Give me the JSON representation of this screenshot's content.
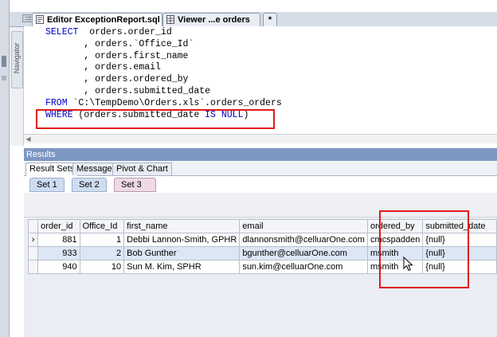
{
  "tabs": [
    {
      "label": "Editor ExceptionReport.sql"
    },
    {
      "label": "Viewer ...e orders"
    },
    {
      "label": "*"
    }
  ],
  "navigator": {
    "label": "Navigator"
  },
  "editor": {
    "lines": [
      {
        "kw": "SELECT",
        "text": "  orders.order_id"
      },
      {
        "kw": "",
        "text": "       , orders.`Office_Id`"
      },
      {
        "kw": "",
        "text": "       , orders.first_name"
      },
      {
        "kw": "",
        "text": "       , orders.email"
      },
      {
        "kw": "",
        "text": "       , orders.ordered_by"
      },
      {
        "kw": "",
        "text": "       , orders.submitted_date"
      },
      {
        "kw": "FROM",
        "text": " `C:\\TempDemo\\Orders.xls`.orders_orders"
      },
      {
        "kw": "WHERE",
        "text": " (orders.submitted_date ",
        "kw2": "IS NULL",
        "tail": ")"
      }
    ]
  },
  "results": {
    "title": "Results",
    "tabs": [
      "Result Sets",
      "Messages",
      "Pivot & Chart"
    ],
    "sets": [
      "Set 1",
      "Set 2",
      "Set 3"
    ],
    "columns": [
      "order_id",
      "Office_Id",
      "first_name",
      "email",
      "ordered_by",
      "submitted_date"
    ],
    "rows": [
      {
        "indicator": "›",
        "order_id": "881",
        "office_id": "1",
        "first_name": "Debbi Lannon-Smith, GPHR",
        "email": "dlannonsmith@celluarOne.com",
        "ordered_by": "cmcspadden",
        "submitted_date": "{null}"
      },
      {
        "indicator": "",
        "order_id": "933",
        "office_id": "2",
        "first_name": "Bob Gunther",
        "email": "bgunther@celluarOne.com",
        "ordered_by": "msmith",
        "submitted_date": "{null}"
      },
      {
        "indicator": "",
        "order_id": "940",
        "office_id": "10",
        "first_name": "Sun M. Kim, SPHR",
        "email": "sun.kim@celluarOne.com",
        "ordered_by": "msmith",
        "submitted_date": "{null}"
      }
    ]
  },
  "colors": {
    "highlight": "#e01c1c",
    "keyword": "#0000c8",
    "results_header": "#7d97c2"
  }
}
